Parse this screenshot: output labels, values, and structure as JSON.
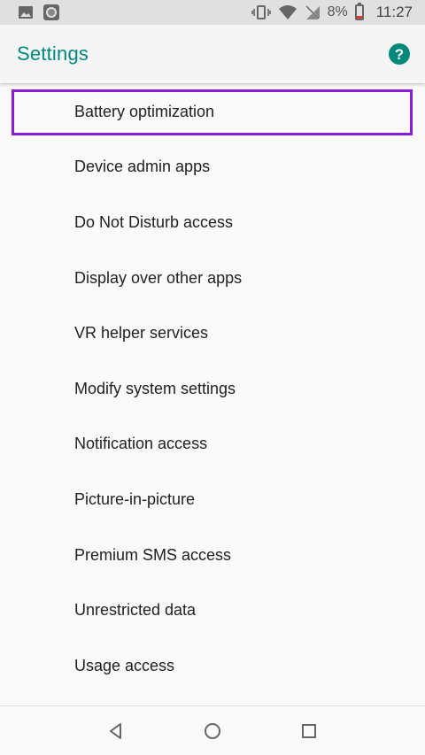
{
  "status_bar": {
    "battery_percent": "8%",
    "time": "11:27",
    "icons": [
      "image-icon",
      "face-icon",
      "vibrate-icon",
      "wifi-icon",
      "no-sim-icon",
      "battery-low-icon"
    ]
  },
  "app_bar": {
    "title": "Settings",
    "help_icon": "help-icon"
  },
  "colors": {
    "accent": "#00897b",
    "highlight": "#8a1bdb",
    "battery_low": "#e53935"
  },
  "list": {
    "items": [
      {
        "label": "Battery optimization"
      },
      {
        "label": "Device admin apps"
      },
      {
        "label": "Do Not Disturb access"
      },
      {
        "label": "Display over other apps"
      },
      {
        "label": "VR helper services"
      },
      {
        "label": "Modify system settings"
      },
      {
        "label": "Notification access"
      },
      {
        "label": "Picture-in-picture"
      },
      {
        "label": "Premium SMS access"
      },
      {
        "label": "Unrestricted data"
      },
      {
        "label": "Usage access"
      }
    ]
  },
  "nav_bar": {
    "buttons": [
      "back-icon",
      "home-icon",
      "recents-icon"
    ]
  }
}
